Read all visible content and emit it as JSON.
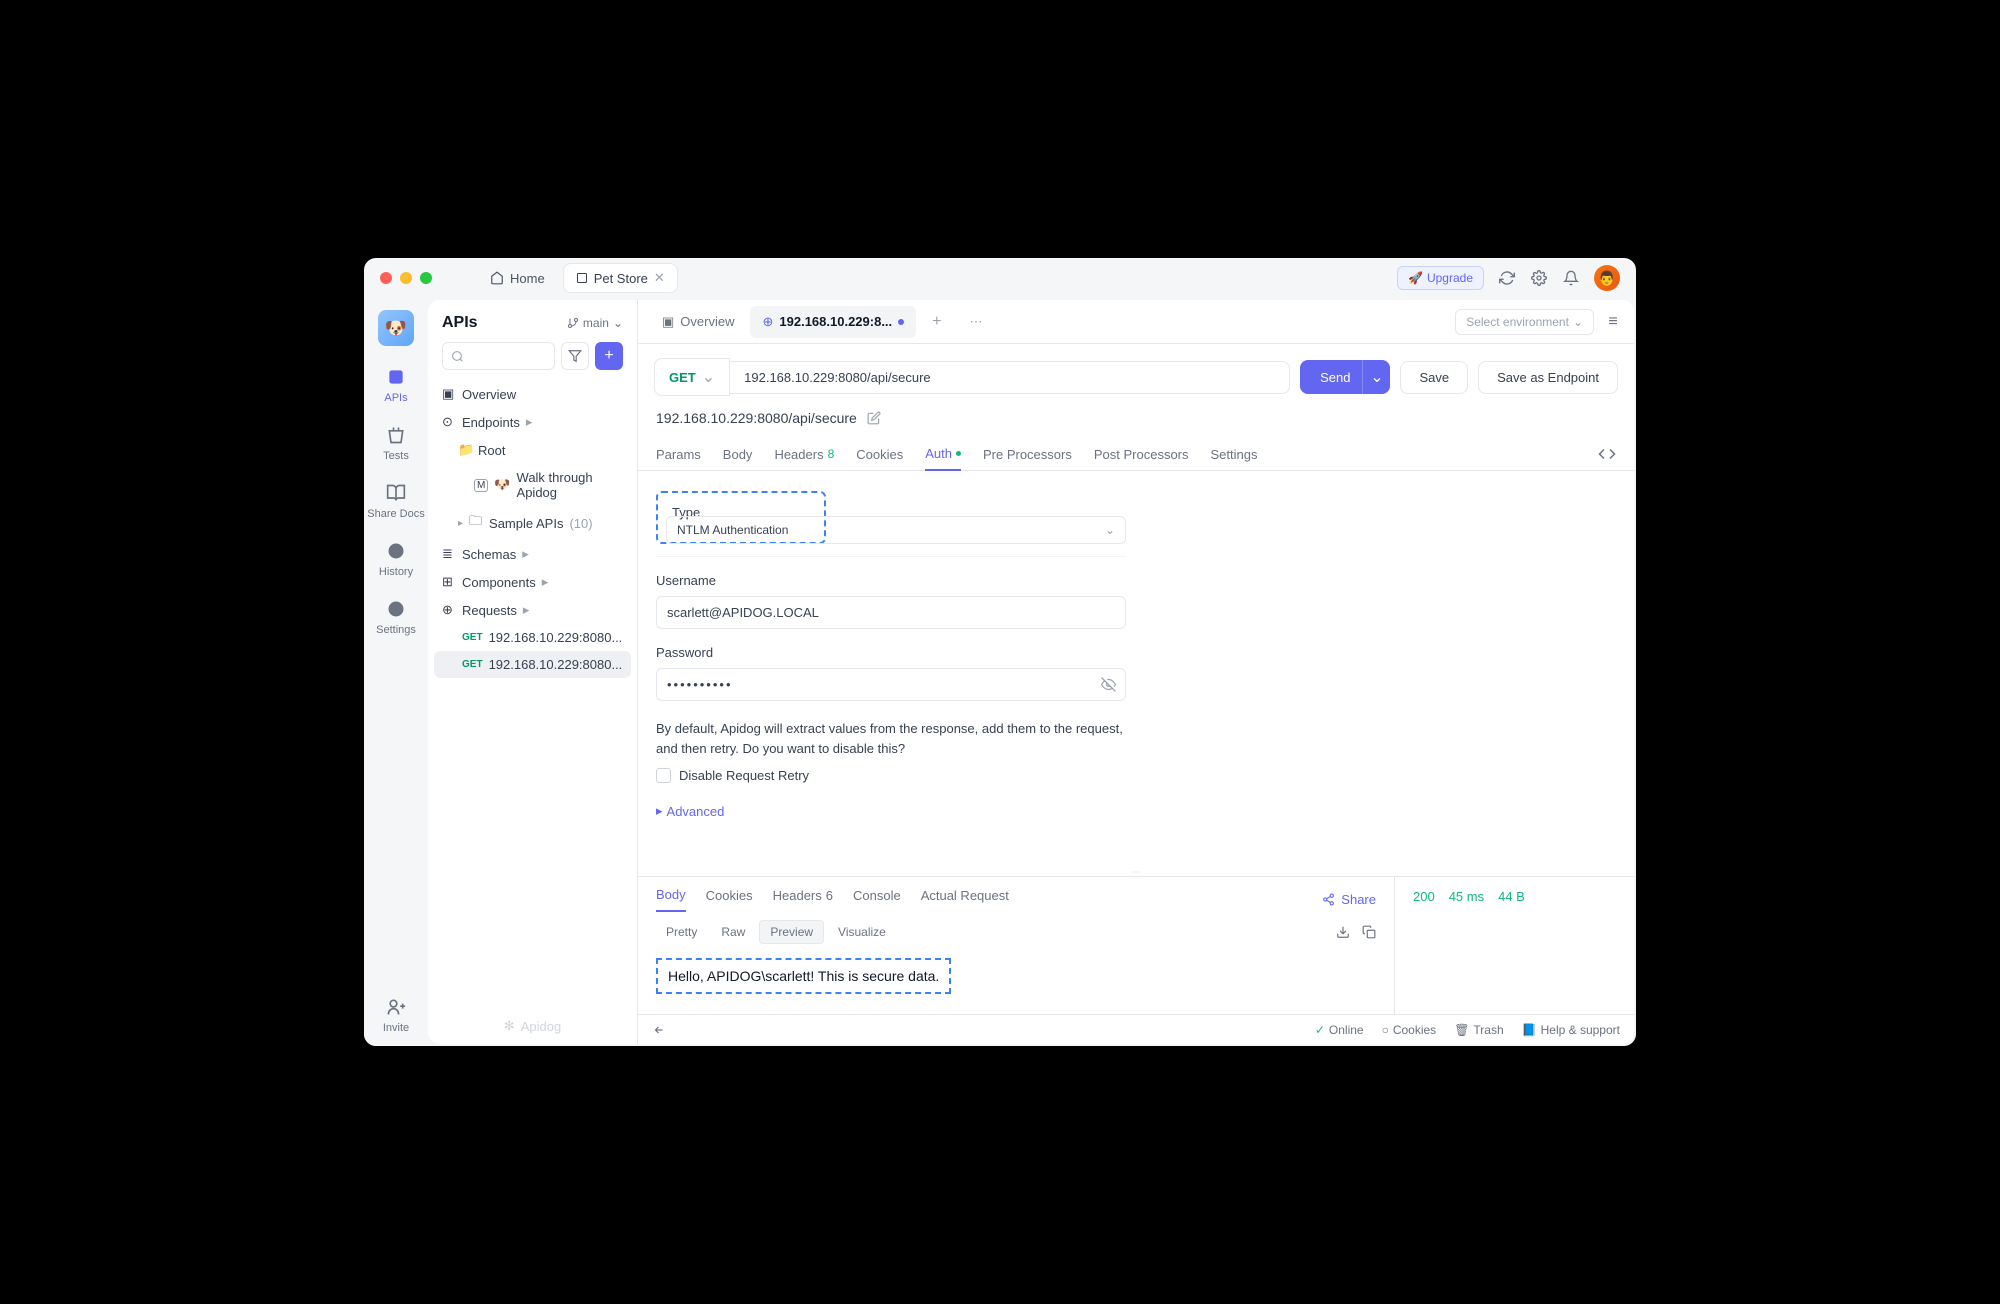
{
  "titlebar": {
    "home": "Home",
    "tab": "Pet Store",
    "upgrade": "Upgrade"
  },
  "nav": {
    "apis": "APIs",
    "tests": "Tests",
    "shareDocs": "Share Docs",
    "history": "History",
    "settings": "Settings",
    "invite": "Invite"
  },
  "sidebar": {
    "title": "APIs",
    "branch": "main",
    "overview": "Overview",
    "endpoints": "Endpoints",
    "root": "Root",
    "walkThrough": "Walk through Apidog",
    "sampleApis": "Sample APIs",
    "sampleApisCount": "(10)",
    "schemas": "Schemas",
    "components": "Components",
    "requests": "Requests",
    "reqItems": [
      {
        "method": "GET",
        "label": "192.168.10.229:8080..."
      },
      {
        "method": "GET",
        "label": "192.168.10.229:8080..."
      }
    ],
    "footerBrand": "Apidog"
  },
  "mainTabs": {
    "overview": "Overview",
    "active": "192.168.10.229:8...",
    "envPlaceholder": "Select environment"
  },
  "request": {
    "method": "GET",
    "url": "192.168.10.229:8080/api/secure",
    "send": "Send",
    "save": "Save",
    "saveEndpoint": "Save as Endpoint",
    "name": "192.168.10.229:8080/api/secure"
  },
  "subTabs": {
    "params": "Params",
    "body": "Body",
    "headers": "Headers",
    "headersCount": "8",
    "cookies": "Cookies",
    "auth": "Auth",
    "pre": "Pre Processors",
    "post": "Post Processors",
    "settings": "Settings"
  },
  "auth": {
    "typeLabel": "Type",
    "typeValue": "NTLM Authentication",
    "usernameLabel": "Username",
    "usernameValue": "scarlett@APIDOG.LOCAL",
    "passwordLabel": "Password",
    "passwordValue": "••••••••••",
    "helpText": "By default, Apidog will extract values from the response, add them to the request, and then retry. Do you want to disable this?",
    "disableRetry": "Disable Request Retry",
    "advanced": "Advanced"
  },
  "response": {
    "tabs": {
      "body": "Body",
      "cookies": "Cookies",
      "headers": "Headers",
      "headersCount": "6",
      "console": "Console",
      "actual": "Actual Request"
    },
    "share": "Share",
    "subTabs": {
      "pretty": "Pretty",
      "raw": "Raw",
      "preview": "Preview",
      "visualize": "Visualize"
    },
    "bodyText": "Hello, APIDOG\\scarlett! This is secure data.",
    "stats": {
      "code": "200",
      "time": "45 ms",
      "size": "44 B"
    }
  },
  "statusbar": {
    "online": "Online",
    "cookies": "Cookies",
    "trash": "Trash",
    "help": "Help & support"
  }
}
